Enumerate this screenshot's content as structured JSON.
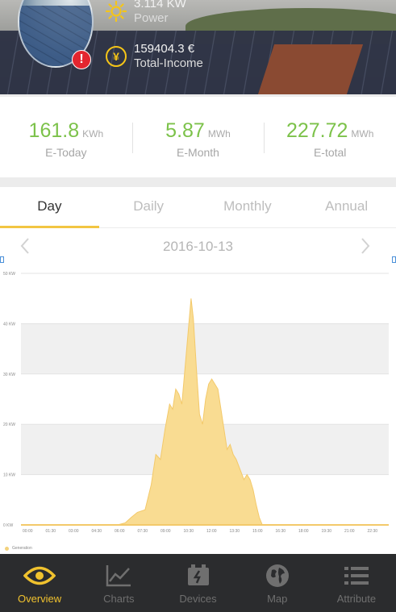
{
  "header": {
    "power": {
      "value": "3.114 KW",
      "label": "Power",
      "icon": "sun-icon"
    },
    "income": {
      "value": "159404.3 €",
      "label": "Total-Income",
      "icon": "yen-icon"
    },
    "alert_badge": "!"
  },
  "summary": [
    {
      "value": "161.8",
      "unit": "KWh",
      "label": "E-Today"
    },
    {
      "value": "5.87",
      "unit": "MWh",
      "label": "E-Month"
    },
    {
      "value": "227.72",
      "unit": "MWh",
      "label": "E-total"
    }
  ],
  "tabs": [
    {
      "label": "Day",
      "active": true
    },
    {
      "label": "Daily",
      "active": false
    },
    {
      "label": "Monthly",
      "active": false
    },
    {
      "label": "Annual",
      "active": false
    }
  ],
  "date_bar": {
    "date": "2016-10-13"
  },
  "chart_data": {
    "type": "area",
    "x_ticks": [
      "00:00",
      "01:30",
      "03:00",
      "04:30",
      "06:00",
      "07:30",
      "09:00",
      "10:30",
      "12:00",
      "13:30",
      "15:00",
      "16:30",
      "18:00",
      "19:30",
      "21:00",
      "22:30"
    ],
    "y_ticks": [
      "0 KW",
      "10 KW",
      "20 KW",
      "30 KW",
      "40 KW",
      "50 KW"
    ],
    "ylim": [
      0,
      50
    ],
    "xlim": [
      0,
      24
    ],
    "series": [
      {
        "name": "Generation",
        "color": "#f9dc92",
        "points": [
          [
            6.3,
            0
          ],
          [
            6.8,
            0.4
          ],
          [
            7.2,
            1.5
          ],
          [
            7.6,
            2.5
          ],
          [
            8.1,
            3
          ],
          [
            8.5,
            8
          ],
          [
            8.8,
            14
          ],
          [
            9.1,
            13
          ],
          [
            9.4,
            19
          ],
          [
            9.7,
            24
          ],
          [
            9.9,
            23
          ],
          [
            10.1,
            27
          ],
          [
            10.3,
            26
          ],
          [
            10.5,
            24
          ],
          [
            10.7,
            31
          ],
          [
            10.9,
            38
          ],
          [
            11.1,
            45
          ],
          [
            11.25,
            41
          ],
          [
            11.45,
            31
          ],
          [
            11.65,
            22
          ],
          [
            11.85,
            20
          ],
          [
            12.05,
            25
          ],
          [
            12.25,
            28
          ],
          [
            12.45,
            29
          ],
          [
            12.65,
            28
          ],
          [
            12.85,
            27
          ],
          [
            13.05,
            23
          ],
          [
            13.25,
            19
          ],
          [
            13.45,
            15
          ],
          [
            13.65,
            16
          ],
          [
            13.85,
            14
          ],
          [
            14.05,
            13
          ],
          [
            14.3,
            11
          ],
          [
            14.55,
            9
          ],
          [
            14.75,
            10
          ],
          [
            14.95,
            9
          ],
          [
            15.15,
            7
          ],
          [
            15.35,
            4
          ],
          [
            15.55,
            1.5
          ],
          [
            15.75,
            0
          ]
        ]
      }
    ],
    "grid": true,
    "legend": "bottom-left"
  },
  "nav": [
    {
      "label": "Overview",
      "icon": "eye-icon",
      "active": true
    },
    {
      "label": "Charts",
      "icon": "line-chart-icon",
      "active": false
    },
    {
      "label": "Devices",
      "icon": "device-icon",
      "active": false
    },
    {
      "label": "Map",
      "icon": "globe-icon",
      "active": false
    },
    {
      "label": "Attribute",
      "icon": "list-icon",
      "active": false
    }
  ],
  "colors": {
    "accent": "#f0c22e",
    "summary_value": "#7cc24a",
    "nav_background": "#2b2c2e",
    "alert": "#e3262f"
  }
}
